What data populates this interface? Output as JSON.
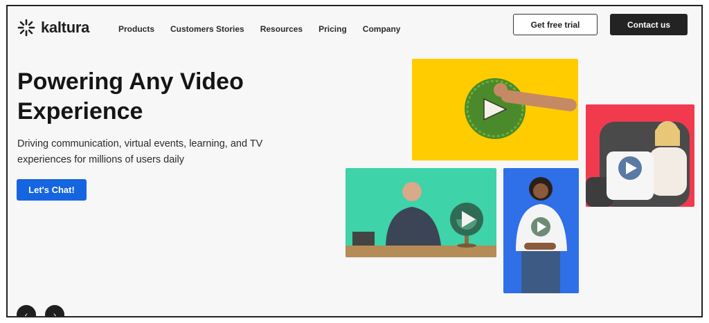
{
  "brand": {
    "name": "kaltura"
  },
  "nav": {
    "items": [
      {
        "label": "Products"
      },
      {
        "label": "Customers Stories"
      },
      {
        "label": "Resources"
      },
      {
        "label": "Pricing"
      },
      {
        "label": "Company"
      }
    ]
  },
  "header": {
    "trial_label": "Get free trial",
    "contact_label": "Contact us"
  },
  "hero": {
    "title_line1": "Powering Any Video",
    "title_line2": "Experience",
    "subtitle_line1": "Driving communication, virtual events, learning, and TV",
    "subtitle_line2": "experiences for millions of users daily",
    "cta_label": "Let's Chat!"
  },
  "carousel": {
    "prev_icon": "‹",
    "next_icon": "›"
  },
  "colors": {
    "cta": "#1565e0",
    "dark_button": "#232323",
    "tile_yellow": "#ffcc00",
    "tile_red": "#f23a4f",
    "tile_green": "#3ed3a8",
    "tile_blue": "#2f6fe8"
  }
}
